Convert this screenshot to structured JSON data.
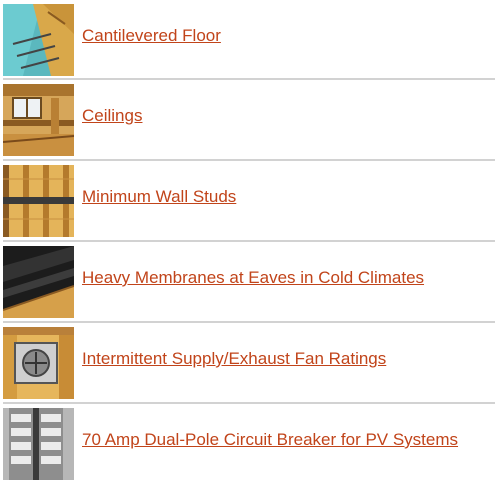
{
  "colors": {
    "link": "#c1441a",
    "divider": "#d2d2d2",
    "background": "#ffffff"
  },
  "items": [
    {
      "label": "Cantilevered Floor",
      "image": "cantilevered-floor-image"
    },
    {
      "label": "Ceilings",
      "image": "ceilings-image"
    },
    {
      "label": "Minimum Wall Studs",
      "image": "wall-studs-image"
    },
    {
      "label": "Heavy Membranes at Eaves in Cold Climates",
      "image": "roof-membrane-image"
    },
    {
      "label": "Intermittent Supply/Exhaust Fan Ratings",
      "image": "exhaust-fan-image"
    },
    {
      "label": "70 Amp Dual-Pole Circuit Breaker for PV Systems",
      "image": "circuit-breaker-image"
    }
  ]
}
